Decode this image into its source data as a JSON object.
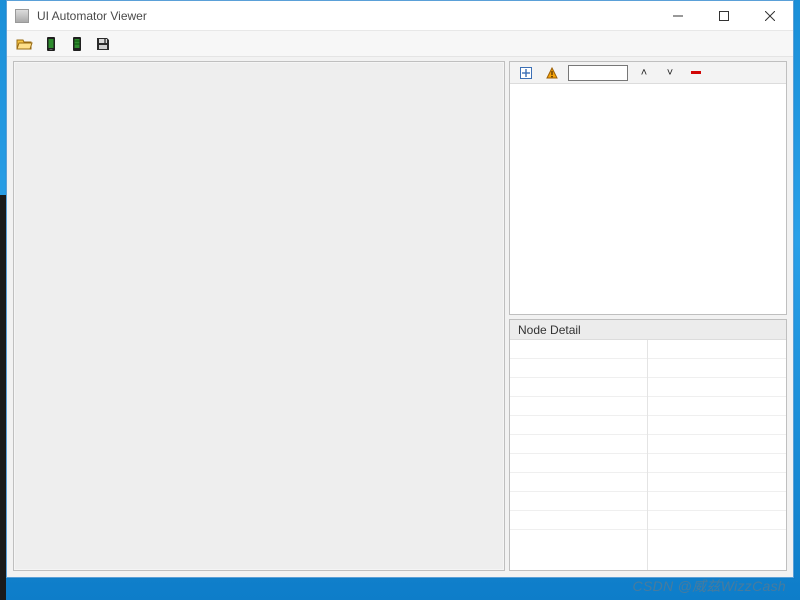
{
  "titlebar": {
    "title": "UI Automator Viewer"
  },
  "toolbar": {
    "open_label": "Open",
    "device_dump_label": "Device Screenshot (uiautomator dump)",
    "device_dump_compressed_label": "Device Screenshot with Compressed Hierarchy",
    "save_label": "Save"
  },
  "tree_toolbar": {
    "expand_all_label": "Expand All",
    "toggle_naf_label": "Toggle NAF Nodes",
    "filter_value": "",
    "prev_label": "Previous",
    "next_label": "Next",
    "delete_label": "Delete"
  },
  "detail": {
    "header": "Node Detail"
  },
  "watermark": "CSDN @威兹WizzCash"
}
